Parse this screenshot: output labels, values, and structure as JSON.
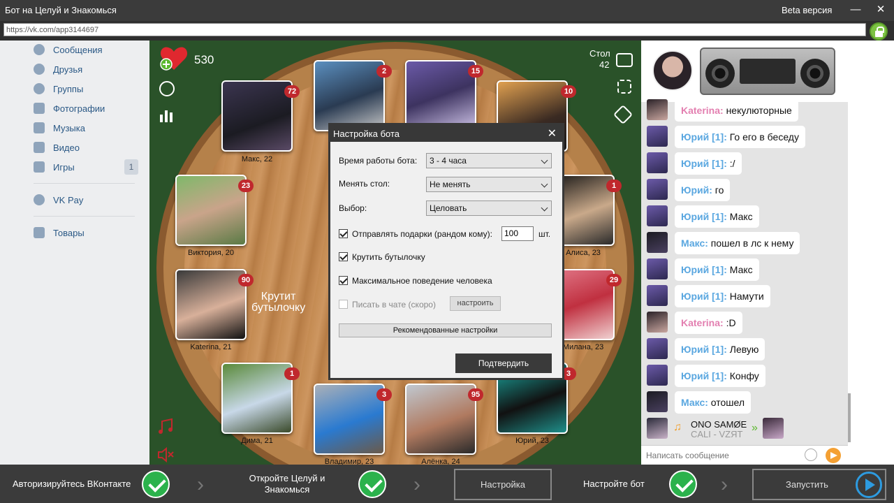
{
  "window": {
    "title": "Бот на Целуй и Знакомься",
    "version_label": "Beta версия",
    "minimize": "—",
    "close": "✕"
  },
  "browser": {
    "url": "https://vk.com/app3144697"
  },
  "sidebar": {
    "items": [
      {
        "label": "Сообщения",
        "icon": "messages-icon"
      },
      {
        "label": "Друзья",
        "icon": "friends-icon"
      },
      {
        "label": "Группы",
        "icon": "groups-icon"
      },
      {
        "label": "Фотографии",
        "icon": "photos-icon"
      },
      {
        "label": "Музыка",
        "icon": "music-icon"
      },
      {
        "label": "Видео",
        "icon": "video-icon"
      },
      {
        "label": "Игры",
        "icon": "games-icon",
        "badge": "1"
      },
      {
        "label": "VK Pay",
        "icon": "vkpay-icon"
      },
      {
        "label": "Товары",
        "icon": "goods-icon"
      }
    ]
  },
  "game": {
    "hearts": "530",
    "table_label": "Стол",
    "table_number": "42",
    "spin_text_line1": "Крутит",
    "spin_text_line2": "бутылочку",
    "players": [
      {
        "name": "Макс, 22",
        "kisses": "72"
      },
      {
        "name": "",
        "kisses": "2"
      },
      {
        "name": "",
        "kisses": "15"
      },
      {
        "name": "",
        "kisses": "10"
      },
      {
        "name": "Виктория, 20",
        "kisses": "23"
      },
      {
        "name": "Алиса, 23",
        "kisses": "1"
      },
      {
        "name": "Katerina, 21",
        "kisses": "90"
      },
      {
        "name": "Милана, 23",
        "kisses": "29"
      },
      {
        "name": "Дима, 21",
        "kisses": "1"
      },
      {
        "name": "Владимир, 23",
        "kisses": "3"
      },
      {
        "name": "Алёнка, 24",
        "kisses": "95"
      },
      {
        "name": "Юрий, 23",
        "kisses": "3"
      }
    ]
  },
  "dialog": {
    "title": "Настройка бота",
    "close": "✕",
    "work_time_label": "Время работы бота:",
    "work_time_value": "3 - 4 часа",
    "change_table_label": "Менять стол:",
    "change_table_value": "Не менять",
    "choice_label": "Выбор:",
    "choice_value": "Целовать",
    "send_gifts_label": "Отправлять подарки (рандом кому):",
    "send_gifts_value": "100",
    "send_gifts_unit": "шт.",
    "spin_bottle_label": "Крутить бутылочку",
    "max_human_label": "Максимальное поведение человека",
    "write_chat_label": "Писать в чате (скоро)",
    "configure_label": "настроить",
    "recommended_label": "Рекомендованные настройки",
    "confirm_label": "Подтвердить"
  },
  "chat": {
    "messages": [
      {
        "name": "Katerina:",
        "text": "некулюторные",
        "kind": "ka"
      },
      {
        "name": "Юрий [1]:",
        "text": "Го его в беседу",
        "kind": "ur"
      },
      {
        "name": "Юрий [1]:",
        "text": ":/",
        "kind": "ur"
      },
      {
        "name": "Юрий:",
        "text": "го",
        "kind": "ur"
      },
      {
        "name": "Юрий [1]:",
        "text": "Макс",
        "kind": "ur"
      },
      {
        "name": "Макс:",
        "text": "пошел в лс к нему",
        "kind": "mk"
      },
      {
        "name": "Юрий [1]:",
        "text": "Макс",
        "kind": "ur"
      },
      {
        "name": "Юрий [1]:",
        "text": "Намути",
        "kind": "ur"
      },
      {
        "name": "Katerina:",
        "text": ":D",
        "kind": "ka"
      },
      {
        "name": "Юрий [1]:",
        "text": "Левую",
        "kind": "ur"
      },
      {
        "name": "Юрий [1]:",
        "text": "Конфу",
        "kind": "ur"
      },
      {
        "name": "Макс:",
        "text": "отошел",
        "kind": "mk"
      }
    ],
    "track_title": "ONO SAMØE",
    "track_artist": "CALI - VZЯT",
    "input_placeholder": "Написать сообщение"
  },
  "steps": {
    "step1": "Авторизируйтесь ВКонтакте",
    "step2_line1": "Откройте Целуй и",
    "step2_line2": "Знакомься",
    "settings_button": "Настройка",
    "step3": "Настройте бот",
    "run_button": "Запустить"
  },
  "colors": {
    "title_bar": "#3b3b3b",
    "vk_link": "#2a5885",
    "table_felt": "#2a5229",
    "check_green": "#2bb24c",
    "run_blue": "#2d9be0"
  }
}
